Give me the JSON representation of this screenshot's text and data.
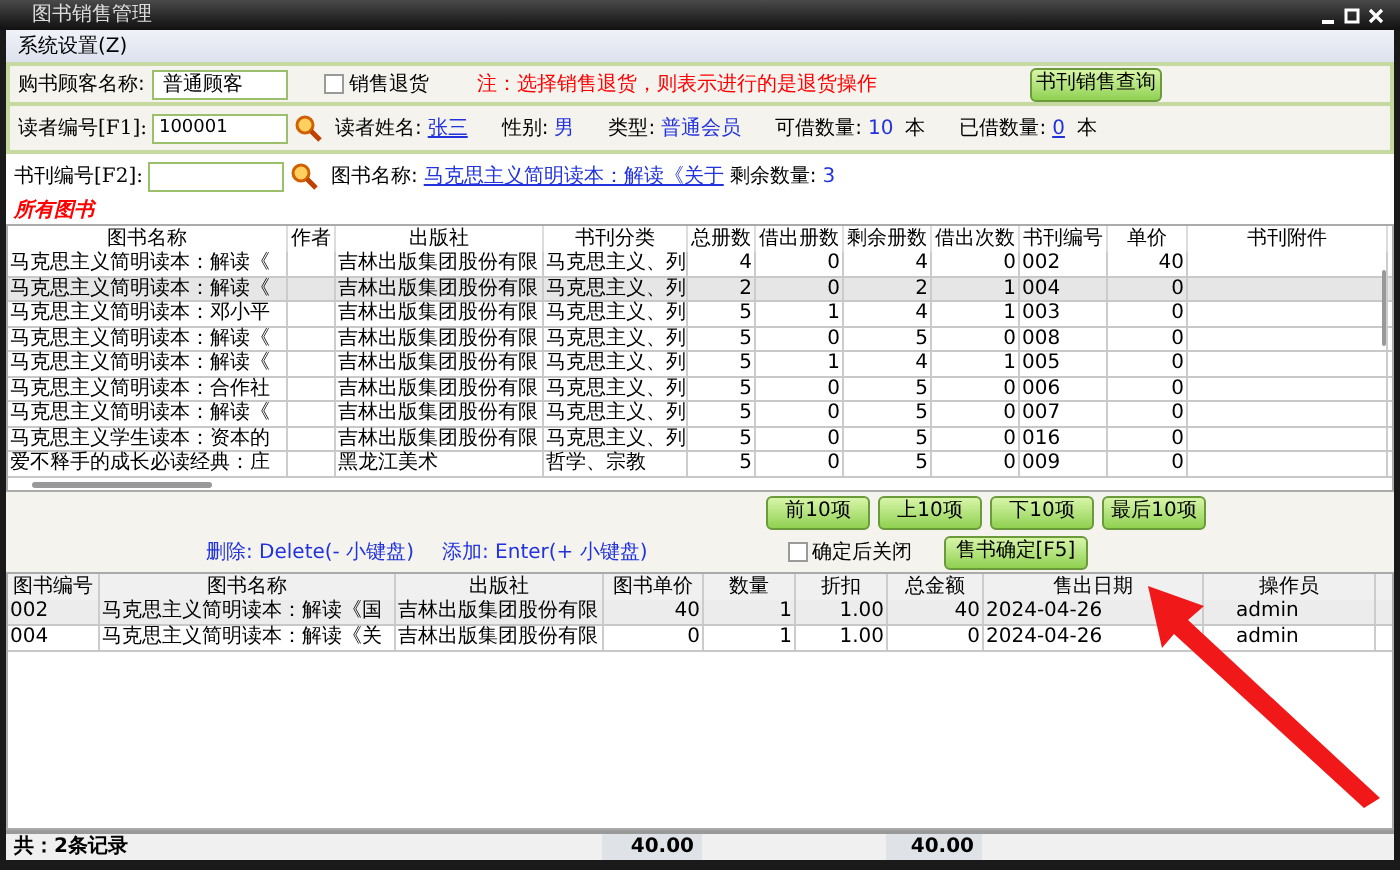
{
  "window": {
    "title": "图书销售管理"
  },
  "menu": [
    "系统设置(Z)"
  ],
  "customer": {
    "label": "购书顾客名称:",
    "value": "普通顾客",
    "return_label": "销售退货",
    "return_checked": false,
    "note": "注：选择销售退货，则表示进行的是退货操作",
    "query_button": "书刊销售查询"
  },
  "reader": {
    "label": "读者编号[F1]:",
    "value": "100001",
    "fields": [
      {
        "label": "读者姓名:",
        "value": "张三"
      },
      {
        "label": "性别:",
        "value": "男"
      },
      {
        "label": "类型:",
        "value": "普通会员"
      },
      {
        "label": "可借数量:",
        "value": "10",
        "unit": "本"
      },
      {
        "label": "已借数量:",
        "value": "0",
        "unit": "本"
      }
    ]
  },
  "book": {
    "label": "书刊编号[F2]:",
    "name_label": "图书名称:",
    "name_value": "马克思主义简明读本：解读《关于",
    "remain_label": "剩余数量:",
    "remain_value": "3"
  },
  "section_title": "所有图书",
  "books_table": {
    "columns": [
      "图书名称",
      "作者",
      "出版社",
      "书刊分类",
      "总册数",
      "借出册数",
      "剩余册数",
      "借出次数",
      "书刊编号",
      "单价",
      "书刊附件"
    ],
    "rows": [
      {
        "selected": false,
        "cells": [
          "马克思主义简明读本：解读《",
          "",
          "吉林出版集团股份有限",
          "马克思主义、列",
          "4",
          "0",
          "4",
          "0",
          "002",
          "40",
          ""
        ]
      },
      {
        "selected": true,
        "cells": [
          "马克思主义简明读本：解读《",
          "",
          "吉林出版集团股份有限",
          "马克思主义、列",
          "2",
          "0",
          "2",
          "1",
          "004",
          "0",
          ""
        ]
      },
      {
        "selected": false,
        "cells": [
          "马克思主义简明读本：邓小平",
          "",
          "吉林出版集团股份有限",
          "马克思主义、列",
          "5",
          "1",
          "4",
          "1",
          "003",
          "0",
          ""
        ]
      },
      {
        "selected": false,
        "cells": [
          "马克思主义简明读本：解读《",
          "",
          "吉林出版集团股份有限",
          "马克思主义、列",
          "5",
          "0",
          "5",
          "0",
          "008",
          "0",
          ""
        ]
      },
      {
        "selected": false,
        "cells": [
          "马克思主义简明读本：解读《",
          "",
          "吉林出版集团股份有限",
          "马克思主义、列",
          "5",
          "1",
          "4",
          "1",
          "005",
          "0",
          ""
        ]
      },
      {
        "selected": false,
        "cells": [
          "马克思主义简明读本：合作社",
          "",
          "吉林出版集团股份有限",
          "马克思主义、列",
          "5",
          "0",
          "5",
          "0",
          "006",
          "0",
          ""
        ]
      },
      {
        "selected": false,
        "cells": [
          "马克思主义简明读本：解读《",
          "",
          "吉林出版集团股份有限",
          "马克思主义、列",
          "5",
          "0",
          "5",
          "0",
          "007",
          "0",
          ""
        ]
      },
      {
        "selected": false,
        "cells": [
          "马克思主义学生读本：资本的",
          "",
          "吉林出版集团股份有限",
          "马克思主义、列",
          "5",
          "0",
          "5",
          "0",
          "016",
          "0",
          ""
        ]
      },
      {
        "selected": false,
        "cells": [
          "爱不释手的成长必读经典：庄",
          "",
          "黑龙江美术",
          "哲学、宗教",
          "5",
          "0",
          "5",
          "0",
          "009",
          "0",
          ""
        ]
      }
    ]
  },
  "pager": [
    "前10项",
    "上10项",
    "下10项",
    "最后10项"
  ],
  "hints": [
    "删除: Delete(- 小键盘)",
    "添加: Enter(+ 小键盘)"
  ],
  "close_after": {
    "label": "确定后关闭",
    "checked": false
  },
  "confirm_button": "售书确定[F5]",
  "sales_table": {
    "columns": [
      "图书编号",
      "图书名称",
      "出版社",
      "图书单价",
      "数量",
      "折扣",
      "总金额",
      "售出日期",
      "操作员"
    ],
    "rows": [
      {
        "selected": true,
        "cells": [
          "002",
          "马克思主义简明读本：解读《国",
          "吉林出版集团股份有限",
          "40",
          "1",
          "1.00",
          "40",
          "2024-04-26",
          "admin"
        ]
      },
      {
        "selected": false,
        "cells": [
          "004",
          "马克思主义简明读本：解读《关",
          "吉林出版集团股份有限",
          "0",
          "1",
          "1.00",
          "0",
          "2024-04-26",
          "admin"
        ]
      }
    ]
  },
  "footer": {
    "count": "共：2条记录",
    "price_total": "40.00",
    "amount_total": "40.00"
  }
}
